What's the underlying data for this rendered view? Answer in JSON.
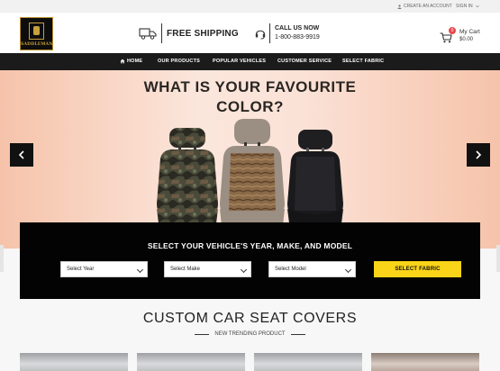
{
  "topbar": {
    "create_account": "CREATE AN ACCOUNT",
    "sign_in": "SIGN IN"
  },
  "header": {
    "logo_text": "SADDLEMAN",
    "shipping": "FREE SHIPPING",
    "call_label": "CALL US NOW",
    "phone": "1-800-883-9919",
    "cart_label": "My Cart",
    "cart_amount": "$0.00",
    "cart_count": "0"
  },
  "nav": {
    "items": [
      "HOME",
      "OUR PRODUCTS",
      "POPULAR VEHICLES",
      "CUSTOMER SERVICE",
      "SELECT FABRIC"
    ]
  },
  "hero": {
    "headline_line1": "WHAT IS YOUR FAVOURITE",
    "headline_line2": "COLOR?"
  },
  "vehicle_selector": {
    "title": "SELECT YOUR VEHICLE'S YEAR, MAKE, AND MODEL",
    "year": "Select Year",
    "make": "Select Make",
    "model": "Select Model",
    "button": "SELECT FABRIC"
  },
  "section": {
    "title": "CUSTOM CAR SEAT COVERS",
    "subtitle": "NEW TRENDING PRODUCT"
  },
  "colors": {
    "nav_bg": "#1b1b1b",
    "accent_yellow": "#f9d418",
    "badge_red": "#e7474b",
    "logo_gold": "#c7a03a"
  }
}
